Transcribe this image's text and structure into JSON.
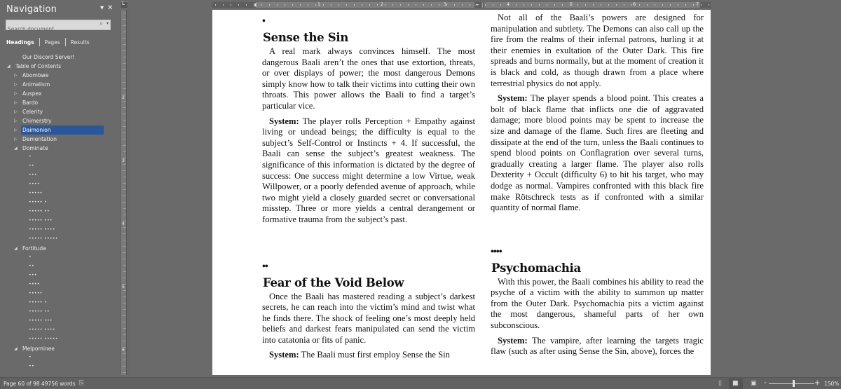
{
  "navigation": {
    "title": "Navigation",
    "dropdown_icon": "▾",
    "close_icon": "✕",
    "search_placeholder": "Search document",
    "search_icon": "⌕",
    "search_dropdown": "▾",
    "tabs": [
      {
        "label": "Headings",
        "active": true
      },
      {
        "label": "Pages",
        "active": false
      },
      {
        "label": "Results",
        "active": false
      }
    ],
    "tree": [
      {
        "label": "Our Discord Server!",
        "level": 1,
        "twisty": ""
      },
      {
        "label": "Table of Contents",
        "level": 0,
        "twisty": "◢"
      },
      {
        "label": "Abombwe",
        "level": 1,
        "twisty": "▷"
      },
      {
        "label": "Animalism",
        "level": 1,
        "twisty": "▷"
      },
      {
        "label": "Auspex",
        "level": 1,
        "twisty": "▷"
      },
      {
        "label": "Bardo",
        "level": 1,
        "twisty": "▷"
      },
      {
        "label": "Celerity",
        "level": 1,
        "twisty": "▷"
      },
      {
        "label": "Chimerstry",
        "level": 1,
        "twisty": "▷"
      },
      {
        "label": "Daimonion",
        "level": 1,
        "twisty": "▷",
        "selected": true
      },
      {
        "label": "Dementation",
        "level": 1,
        "twisty": "▷"
      },
      {
        "label": "Dominate",
        "level": 1,
        "twisty": "◢"
      },
      {
        "label": "•",
        "level": 2,
        "dots": true
      },
      {
        "label": "••",
        "level": 2,
        "dots": true
      },
      {
        "label": "•••",
        "level": 2,
        "dots": true
      },
      {
        "label": "••••",
        "level": 2,
        "dots": true
      },
      {
        "label": "•••••",
        "level": 2,
        "dots": true
      },
      {
        "label": "••••• •",
        "level": 2,
        "dots": true
      },
      {
        "label": "••••• ••",
        "level": 2,
        "dots": true
      },
      {
        "label": "••••• •••",
        "level": 2,
        "dots": true
      },
      {
        "label": "••••• ••••",
        "level": 2,
        "dots": true
      },
      {
        "label": "••••• •••••",
        "level": 2,
        "dots": true
      },
      {
        "label": "Fortitude",
        "level": 1,
        "twisty": "◢"
      },
      {
        "label": "•",
        "level": 2,
        "dots": true
      },
      {
        "label": "••",
        "level": 2,
        "dots": true
      },
      {
        "label": "•••",
        "level": 2,
        "dots": true
      },
      {
        "label": "••••",
        "level": 2,
        "dots": true
      },
      {
        "label": "•••••",
        "level": 2,
        "dots": true
      },
      {
        "label": "••••• •",
        "level": 2,
        "dots": true
      },
      {
        "label": "••••• ••",
        "level": 2,
        "dots": true
      },
      {
        "label": "••••• •••",
        "level": 2,
        "dots": true
      },
      {
        "label": "••••• ••••",
        "level": 2,
        "dots": true
      },
      {
        "label": "••••• •••••",
        "level": 2,
        "dots": true
      },
      {
        "label": "Melpominee",
        "level": 1,
        "twisty": "◢"
      },
      {
        "label": "•",
        "level": 2,
        "dots": true
      },
      {
        "label": "••",
        "level": 2,
        "dots": true
      }
    ]
  },
  "ruler": {
    "corner_glyph": "L",
    "h_numbers": [
      "1",
      "2",
      "3",
      "4",
      "5",
      "6",
      "7"
    ],
    "v_numbers": [
      "2",
      "3",
      "4",
      "5",
      "6"
    ]
  },
  "document": {
    "left_column": {
      "sections": [
        {
          "level": "•",
          "title": "Sense the Sin",
          "paragraphs": [
            {
              "lead": "",
              "text": "A real mark always convinces himself. The most dangerous Baali aren’t the ones that use extortion, threats, or over displays of power; the most dangerous Demons simply know how to talk their victims into cutting their own throats. This power allows the Baali to find a target’s particular vice."
            },
            {
              "lead": "System:",
              "text": " The player rolls Perception + Empathy against living or undead beings; the difficulty is equal to the subject’s Self-Control or Instincts + 4. If successful, the Baali can sense the subject’s greatest weakness. The significance of this information is dictated by the degree of success: One success might determine a low Virtue, weak Willpower, or a poorly defended avenue of approach, while two might yield a closely guarded secret or conversational misstep. Three or more yields a central derangement or formative trauma from the subject’s past."
            }
          ]
        },
        {
          "level": "••",
          "title": "Fear of the Void Below",
          "paragraphs": [
            {
              "lead": "",
              "text": "Once the Baali has mastered reading a subject’s darkest secrets, he can reach into the victim’s mind and twist what he finds there. The shock of feeling one’s most deeply held beliefs and darkest fears manipulated can send the victim into catatonia or fits of panic."
            },
            {
              "lead": "System:",
              "text": " The Baali must first employ Sense the Sin"
            }
          ]
        }
      ]
    },
    "right_column": {
      "intro_paragraphs": [
        {
          "lead": "",
          "text": "Not all of the Baali’s powers are designed for manipulation and subtlety. The Demons can also call up the fire from the realms of their infernal patrons, hurling it at their enemies in exultation of the Outer Dark. This fire spreads and burns normally, but at the moment of creation it is black and cold, as though drawn from a place where terrestrial physics do not apply."
        },
        {
          "lead": "System:",
          "text": " The player spends a blood point. This creates a bolt of black flame that inflicts one die of aggravated damage; more blood points may be spent to increase the size and damage of the flame. Such fires are fleeting and dissipate at the end of the turn, unless the Baali continues to spend blood points on Conflagration over several turns, gradually creating a larger flame. The player also rolls Dexterity + Occult (difficulty 6) to hit his target, who may dodge as normal. Vampires confronted with this black fire make Rötschreck tests as if confronted with a similar quantity of normal flame."
        }
      ],
      "section": {
        "level": "••••",
        "title": "Psychomachia",
        "paragraphs": [
          {
            "lead": "",
            "text": "With this power, the Baali combines his ability to read the psyche of a victim with the ability to summon up matter from the Outer Dark. Psychomachia pits a victim against the most dangerous, shameful parts of her own subconscious."
          },
          {
            "lead": "System:",
            "text": " The vampire, after learning the targets tragic flaw (such as after using Sense the Sin, above), forces the"
          }
        ]
      }
    }
  },
  "status_bar": {
    "page": "Page 60 of 98",
    "words": "49756 words",
    "proofing_icon": "proofing-icon",
    "zoom_minus": "-",
    "zoom_plus": "+",
    "zoom_level": "150%",
    "zoom_value_percent": 150
  }
}
